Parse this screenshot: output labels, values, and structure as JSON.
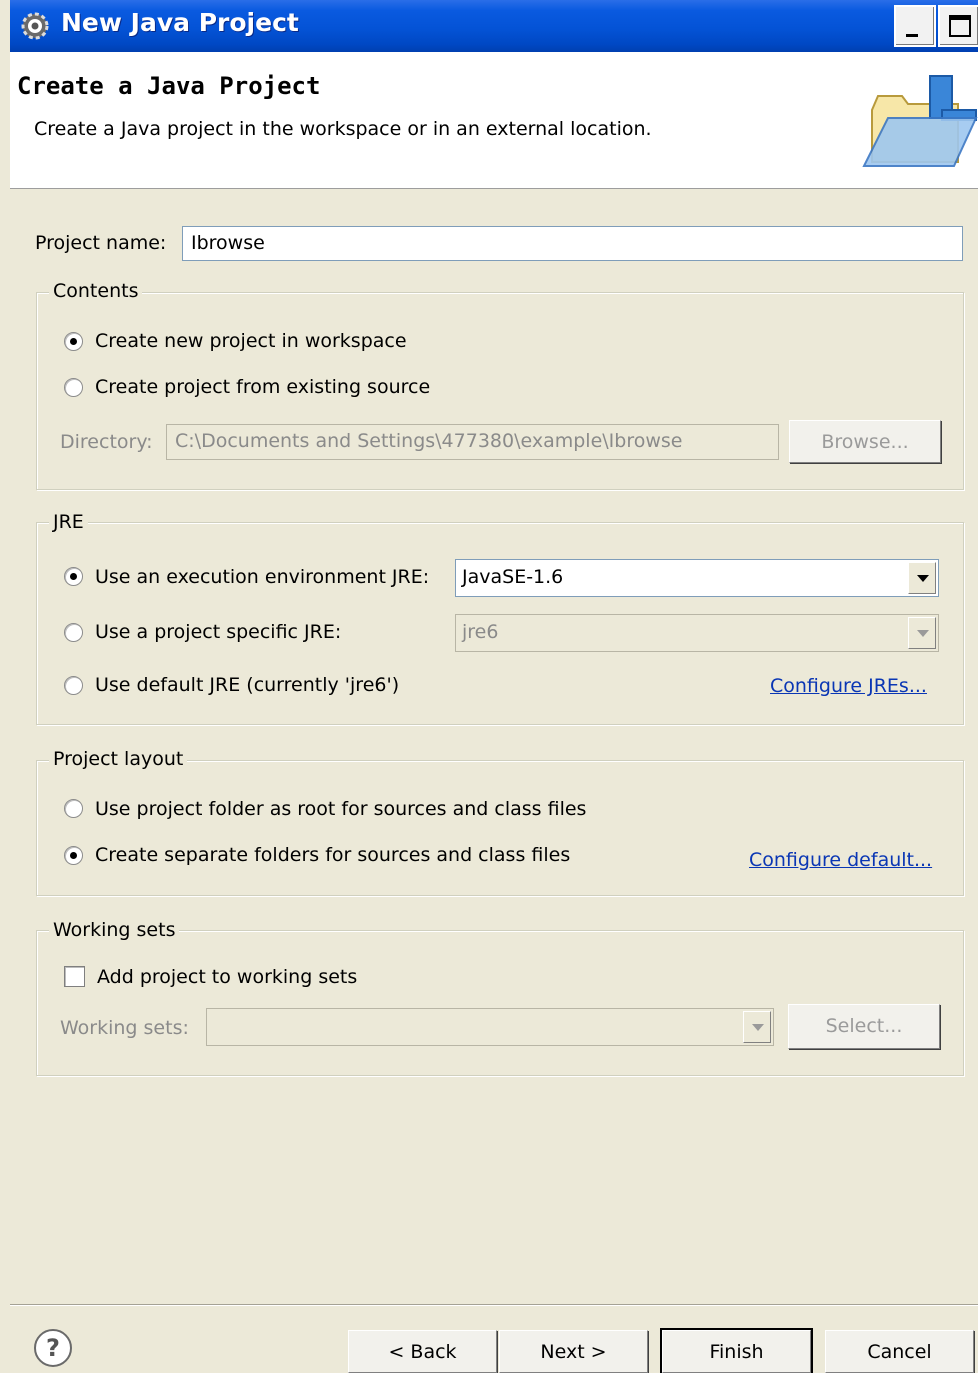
{
  "window": {
    "title": "New Java Project"
  },
  "banner": {
    "heading": "Create a Java Project",
    "description": "Create a Java project in the workspace or in an external location.",
    "icon": "new-java-project-folder-icon"
  },
  "project_name": {
    "label": "Project name:",
    "value": "Ibrowse"
  },
  "contents": {
    "title": "Contents",
    "options": [
      {
        "label": "Create new project in workspace",
        "checked": true
      },
      {
        "label": "Create project from existing source",
        "checked": false
      }
    ],
    "directory_label": "Directory:",
    "directory_value": "C:\\Documents and Settings\\477380\\example\\Ibrowse",
    "browse_label": "Browse..."
  },
  "jre": {
    "title": "JRE",
    "options": [
      {
        "label": "Use an execution environment JRE:",
        "checked": true
      },
      {
        "label": "Use a project specific JRE:",
        "checked": false
      },
      {
        "label": "Use default JRE (currently 'jre6')",
        "checked": false
      }
    ],
    "execution_env_value": "JavaSE-1.6",
    "project_jre_value": "jre6",
    "configure_link": "Configure JREs..."
  },
  "layout": {
    "title": "Project layout",
    "options": [
      {
        "label": "Use project folder as root for sources and class files",
        "checked": false
      },
      {
        "label": "Create separate folders for sources and class files",
        "checked": true
      }
    ],
    "configure_link": "Configure default..."
  },
  "working_sets": {
    "title": "Working sets",
    "checkbox_label": "Add project to working sets",
    "checked": false,
    "field_label": "Working sets:",
    "field_value": "",
    "select_label": "Select..."
  },
  "footer": {
    "help": "?",
    "back": "< Back",
    "next": "Next >",
    "finish": "Finish",
    "cancel": "Cancel"
  }
}
